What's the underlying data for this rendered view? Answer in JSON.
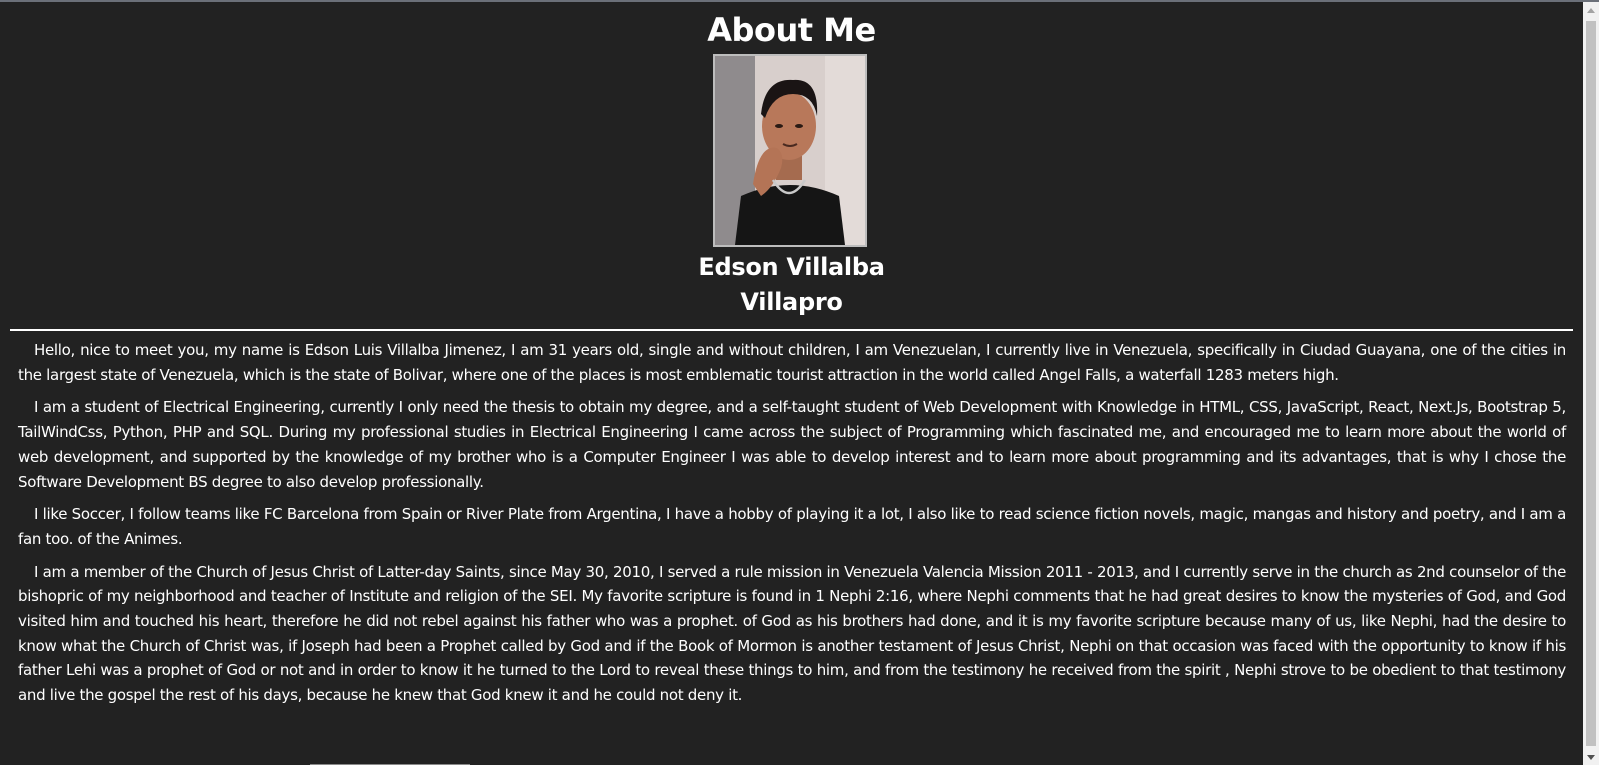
{
  "page": {
    "title": "About Me",
    "photo_alt": "Edson Villalba profile photo",
    "name_line1": "Edson Villalba",
    "name_line2": "Villapro"
  },
  "bio": {
    "paragraphs": [
      "Hello, nice to meet you, my name is Edson Luis Villalba Jimenez, I am 31 years old, single and without children, I am Venezuelan, I currently live in Venezuela, specifically in Ciudad Guayana, one of the cities in the largest state of Venezuela, which is the state of Bolivar, where one of the places is most emblematic tourist attraction in the world called Angel Falls, a waterfall 1283 meters high.",
      "I am a student of Electrical Engineering, currently I only need the thesis to obtain my degree, and a self-taught student of Web Development with Knowledge in HTML, CSS, JavaScript, React, Next.Js, Bootstrap 5, TailWindCss, Python, PHP and SQL. During my professional studies in Electrical Engineering I came across the subject of Programming which fascinated me, and encouraged me to learn more about the world of web development, and supported by the knowledge of my brother who is a Computer Engineer I was able to develop interest and to learn more about programming and its advantages, that is why I chose the Software Development BS degree to also develop professionally.",
      "I like Soccer, I follow teams like FC Barcelona from Spain or River Plate from Argentina, I have a hobby of playing it a lot, I also like to read science fiction novels, magic, mangas and history and poetry, and I am a fan too. of the Animes.",
      "I am a member of the Church of Jesus Christ of Latter-day Saints, since May 30, 2010, I served a rule mission in Venezuela Valencia Mission 2011 - 2013, and I currently serve in the church as 2nd counselor of the bishopric of my neighborhood and teacher of Institute and religion of the SEI. My favorite scripture is found in 1 Nephi 2:16, where Nephi comments that he had great desires to know the mysteries of God, and God visited him and touched his heart, therefore he did not rebel against his father who was a prophet. of God as his brothers had done, and it is my favorite scripture because many of us, like Nephi, had the desire to know what the Church of Christ was, if Joseph had been a Prophet called by God and if the Book of Mormon is another testament of Jesus Christ, Nephi on that occasion was faced with the opportunity to know if his father Lehi was a prophet of God or not and in order to know it he turned to the Lord to reveal these things to him, and from the testimony he received from the spirit , Nephi strove to be obedient to that testimony and live the gospel the rest of his days, because he knew that God knew it and he could not deny it."
    ]
  },
  "icons": {
    "scroll_up": "chevron-up-icon",
    "scroll_down": "chevron-down-icon"
  },
  "colors": {
    "background": "#222222",
    "text": "#ffffff",
    "divider": "#ffffff",
    "photo_border": "#bdbdbd",
    "scrollbar_track": "#f1f1f1",
    "scrollbar_thumb": "#c1c1c1"
  }
}
